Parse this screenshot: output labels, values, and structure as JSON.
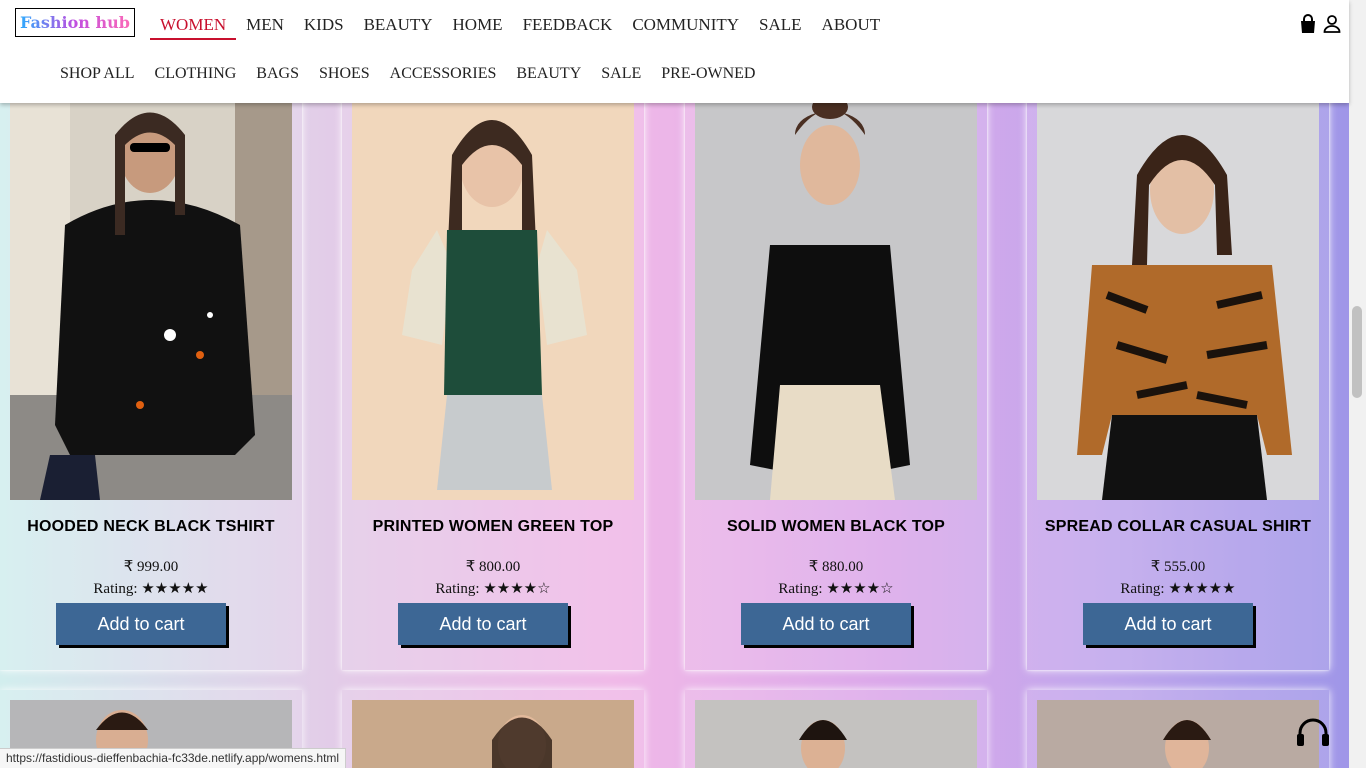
{
  "brand": {
    "logo_text": "Fashion hub"
  },
  "top_nav": [
    {
      "label": "WOMEN",
      "active": true
    },
    {
      "label": "MEN"
    },
    {
      "label": "KIDS"
    },
    {
      "label": "BEAUTY"
    },
    {
      "label": "HOME"
    },
    {
      "label": "FEEDBACK"
    },
    {
      "label": "COMMUNITY"
    },
    {
      "label": "SALE"
    },
    {
      "label": "ABOUT"
    }
  ],
  "sub_nav": [
    {
      "label": "SHOP ALL"
    },
    {
      "label": "CLOTHING"
    },
    {
      "label": "BAGS"
    },
    {
      "label": "SHOES"
    },
    {
      "label": "ACCESSORIES"
    },
    {
      "label": "BEAUTY"
    },
    {
      "label": "SALE"
    },
    {
      "label": "PRE-OWNED"
    }
  ],
  "header_icons": {
    "bag": "shopping-bag-icon",
    "user": "user-icon"
  },
  "products": [
    {
      "title": "HOODED NECK BLACK TSHIRT",
      "price": "₹ 999.00",
      "rating": "Rating: ★★★★★",
      "button": "Add to cart"
    },
    {
      "title": "PRINTED WOMEN GREEN TOP",
      "price": "₹ 800.00",
      "rating": "Rating: ★★★★☆",
      "button": "Add to cart"
    },
    {
      "title": "SOLID WOMEN BLACK TOP",
      "price": "₹ 880.00",
      "rating": "Rating: ★★★★☆",
      "button": "Add to cart"
    },
    {
      "title": "SPREAD COLLAR CASUAL SHIRT",
      "price": "₹ 555.00",
      "rating": "Rating: ★★★★★",
      "button": "Add to cart"
    }
  ],
  "status_url": "https://fastidious-dieffenbachia-fc33de.netlify.app/womens.html",
  "colors": {
    "accent": "#c8102e",
    "button": "#3d6795"
  }
}
